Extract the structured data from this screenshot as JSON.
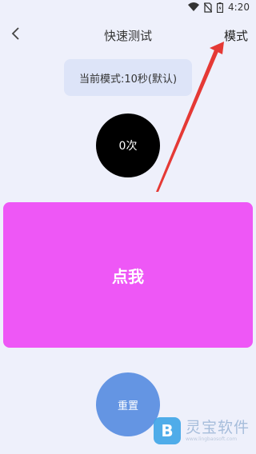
{
  "status_bar": {
    "time": "4:20"
  },
  "header": {
    "title": "快速测试",
    "mode_label": "模式"
  },
  "mode_chip": {
    "text": "当前模式:10秒(默认)"
  },
  "counter": {
    "text": "0次"
  },
  "tap_button": {
    "label": "点我"
  },
  "reset_button": {
    "label": "重置"
  },
  "watermark": {
    "name": "灵宝软件",
    "url": "www.lingbaosoft.com"
  },
  "colors": {
    "background": "#eef0fb",
    "chip": "#dde4f8",
    "counter": "#000000",
    "tap_button": "#ee57f6",
    "reset_button": "#6495e3",
    "annotation_arrow": "#e53935"
  },
  "icons": [
    "wifi-icon",
    "no-sim-icon",
    "battery-charging-icon",
    "back-arrow-icon"
  ]
}
